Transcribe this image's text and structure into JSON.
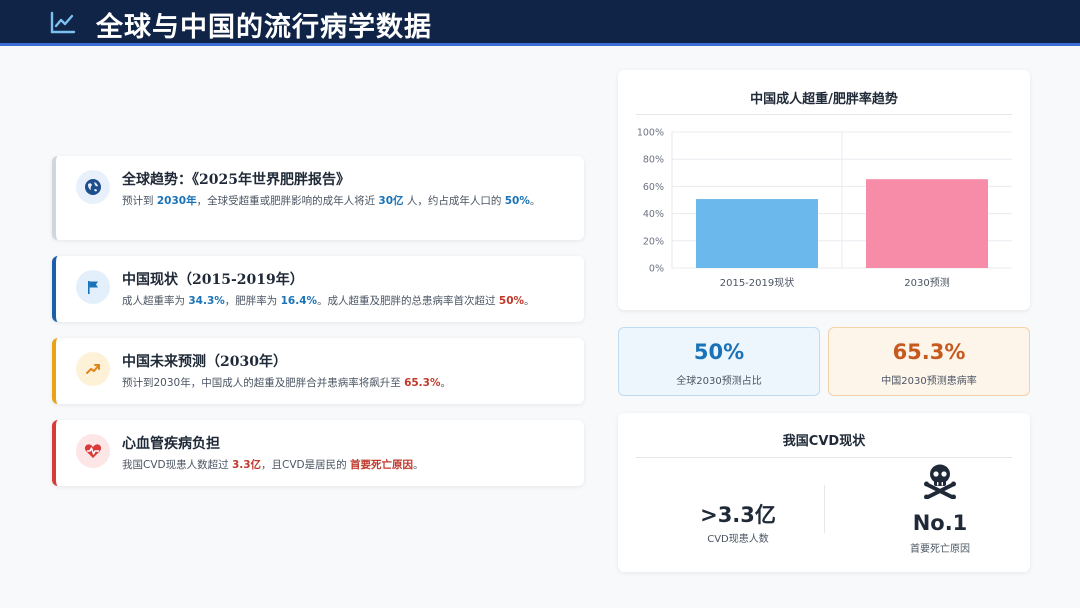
{
  "header": {
    "title": "全球与中国的流行病学数据",
    "icon": "line-chart-icon"
  },
  "cards": [
    {
      "icon": "globe-icon",
      "title": "全球趋势：《2025年世界肥胖报告》",
      "desc": [
        "预计到 ",
        "2030年",
        "，全球受超重或肥胖影响的成年人将近 ",
        "30亿",
        " 人，约占成年人口的 ",
        "50%",
        "。"
      ],
      "border": "#cfd6de",
      "icon_bg": "#e8f1fb",
      "icon_color": "#1f4e8c"
    },
    {
      "icon": "flag-icon",
      "title": "中国现状（2015-2019年）",
      "desc": [
        "成人超重率为 ",
        "34.3%",
        "，肥胖率为 ",
        "16.4%",
        "。成人超重及肥胖的总患病率首次超过 ",
        "50%",
        "。"
      ],
      "border": "#1a5fa8",
      "icon_bg": "#e3f0fc",
      "icon_color": "#1a73b8"
    },
    {
      "icon": "trend-up-icon",
      "title": "中国未来预测（2030年）",
      "desc": [
        "预计到2030年，中国成人的超重及肥胖合并患病率将飙升至 ",
        "65.3%",
        "。"
      ],
      "border": "#e8a317",
      "icon_bg": "#fdf1d8",
      "icon_color": "#e0851a"
    },
    {
      "icon": "heart-pulse-icon",
      "title": "心血管疾病负担",
      "desc": [
        "我国CVD现患人数超过 ",
        "3.3亿",
        "，且CVD是居民的 ",
        "首要死亡原因",
        "。"
      ],
      "border": "#d93a3a",
      "icon_bg": "#fde6e6",
      "icon_color": "#d93a3a"
    }
  ],
  "chart_data": {
    "type": "bar",
    "title": "中国成人超重/肥胖率趋势",
    "categories": [
      "2015-2019现状",
      "2030预测"
    ],
    "values": [
      50.7,
      65.3
    ],
    "colors": [
      "#6bb8ec",
      "#f78ca8"
    ],
    "ylim": [
      0,
      100
    ],
    "yticks": [
      "0%",
      "20%",
      "40%",
      "60%",
      "80%",
      "100%"
    ],
    "grid": true
  },
  "stats": [
    {
      "value": "50%",
      "label": "全球2030预测占比"
    },
    {
      "value": "65.3%",
      "label": "中国2030预测患病率"
    }
  ],
  "cvd": {
    "title": "我国CVD现状",
    "left": {
      "value": ">3.3亿",
      "label": "CVD现患人数"
    },
    "right": {
      "value": "No.1",
      "label": "首要死亡原因",
      "icon": "skull-crossbones-icon"
    }
  }
}
